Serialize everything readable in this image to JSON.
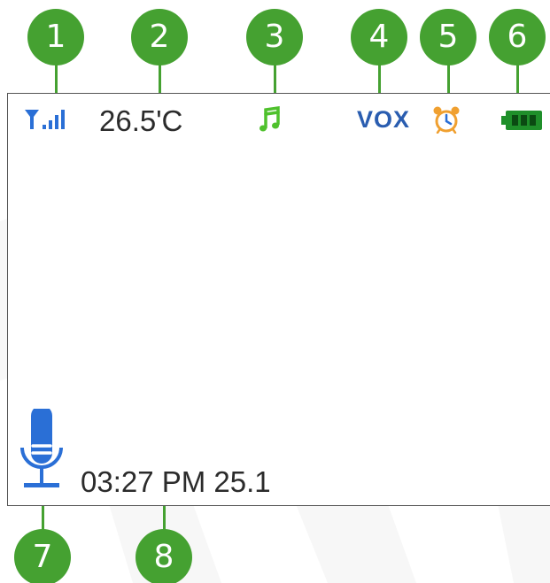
{
  "status_bar": {
    "signal_icon": "signal-strength-icon",
    "temperature": "26.5'C",
    "music_icon": "music-note-icon",
    "vox_label": "VOX",
    "alarm_icon": "alarm-clock-icon",
    "battery_icon": "battery-full-icon"
  },
  "bottom_bar": {
    "mic_icon": "microphone-icon",
    "datetime": "03:27 PM 25.1"
  },
  "callouts": [
    "1",
    "2",
    "3",
    "4",
    "5",
    "6",
    "7",
    "8"
  ],
  "colors": {
    "callout": "#45a131",
    "icon_blue": "#2a6fd6",
    "music_green": "#4fc12d",
    "battery_green": "#1f8f2a",
    "alarm_orange": "#f0a030"
  }
}
